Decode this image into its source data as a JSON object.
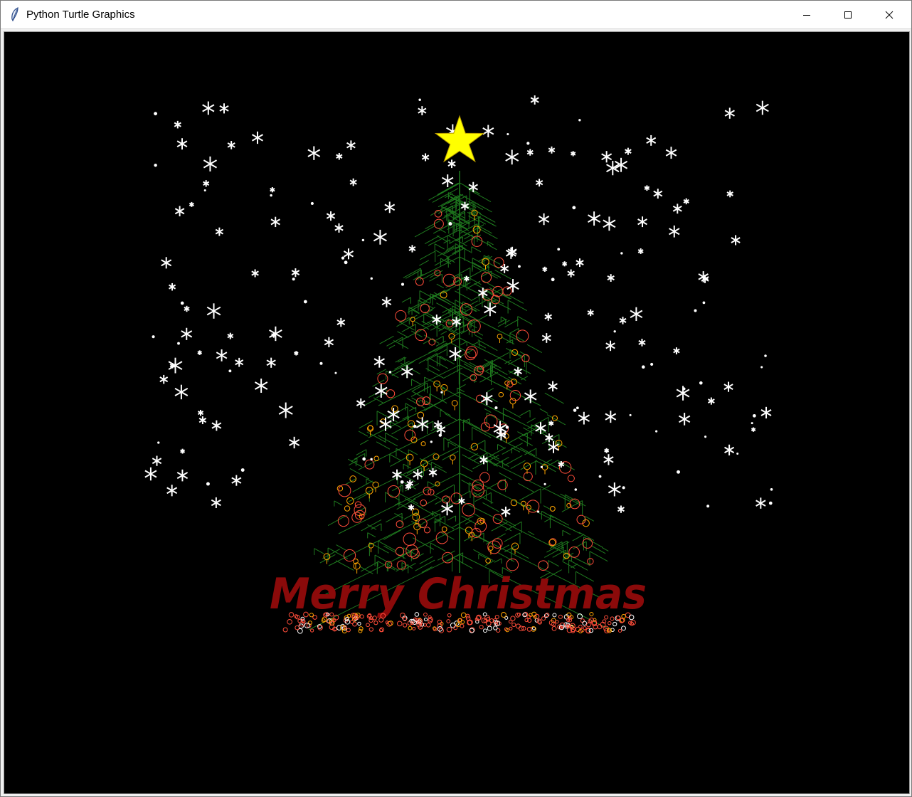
{
  "window": {
    "title": "Python Turtle Graphics",
    "icon": "feather-icon",
    "controls": [
      "minimize-icon",
      "maximize-icon",
      "close-icon"
    ]
  },
  "canvas": {
    "background": "#000000",
    "greeting": "Merry Christmas",
    "greeting_color": "#8b0a0a",
    "star_color": "#ffff00",
    "tree_color": "#1f7a1f",
    "ornament_colors": [
      "#ff4d3a",
      "#ffa500",
      "#ffffff"
    ],
    "snow_color": "#ffffff"
  }
}
